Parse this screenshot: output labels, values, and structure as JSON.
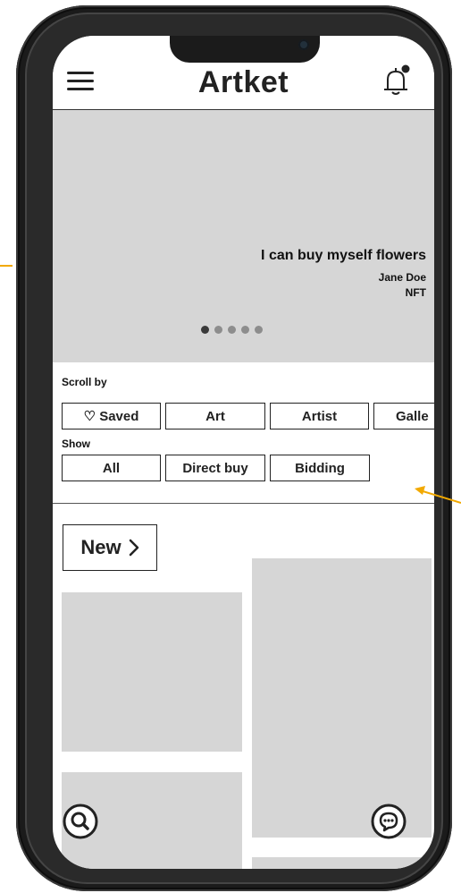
{
  "app": {
    "title": "Artket"
  },
  "banner": {
    "title": "I can buy myself flowers",
    "artist": "Jane Doe",
    "type": "NFT",
    "slides": 5,
    "active_slide": 1
  },
  "scroll_by": {
    "label": "Scroll by",
    "options": [
      "♡ Saved",
      "Art",
      "Artist",
      "Galle"
    ]
  },
  "show": {
    "label": "Show",
    "options": [
      "All",
      "Direct buy",
      "Bidding"
    ]
  },
  "section": {
    "new_label": "New"
  },
  "colors": {
    "placeholder": "#d6d6d6",
    "frame": "#1b1b1b",
    "text": "#222222"
  },
  "icons": {
    "menu": "menu-icon",
    "bell": "bell-icon",
    "search": "search-icon",
    "chat": "chat-icon",
    "chevron": "chevron-right-icon"
  }
}
